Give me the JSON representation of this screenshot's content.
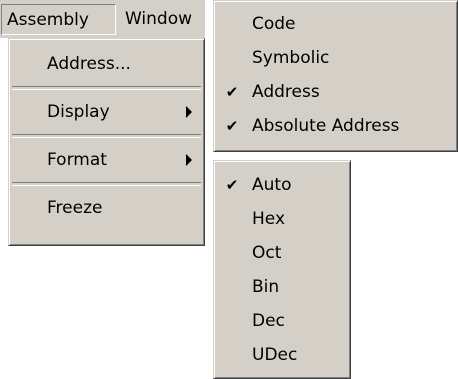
{
  "menubar": {
    "items": [
      {
        "label": "Assembly"
      },
      {
        "label": "Window"
      }
    ]
  },
  "assembly_menu": {
    "items": [
      {
        "label": "Address..."
      },
      {
        "label": "Display",
        "submenu": true
      },
      {
        "label": "Format",
        "submenu": true
      },
      {
        "label": "Freeze"
      }
    ]
  },
  "display_submenu": {
    "items": [
      {
        "label": "Code",
        "checked": false
      },
      {
        "label": "Symbolic",
        "checked": false
      },
      {
        "label": "Address",
        "checked": true
      },
      {
        "label": "Absolute Address",
        "checked": true
      }
    ]
  },
  "format_submenu": {
    "items": [
      {
        "label": "Auto",
        "checked": true
      },
      {
        "label": "Hex",
        "checked": false
      },
      {
        "label": "Oct",
        "checked": false
      },
      {
        "label": "Bin",
        "checked": false
      },
      {
        "label": "Dec",
        "checked": false
      },
      {
        "label": "UDec",
        "checked": false
      }
    ]
  },
  "icons": {
    "check": "✔",
    "submenu_arrow": "chevron-right-icon"
  }
}
